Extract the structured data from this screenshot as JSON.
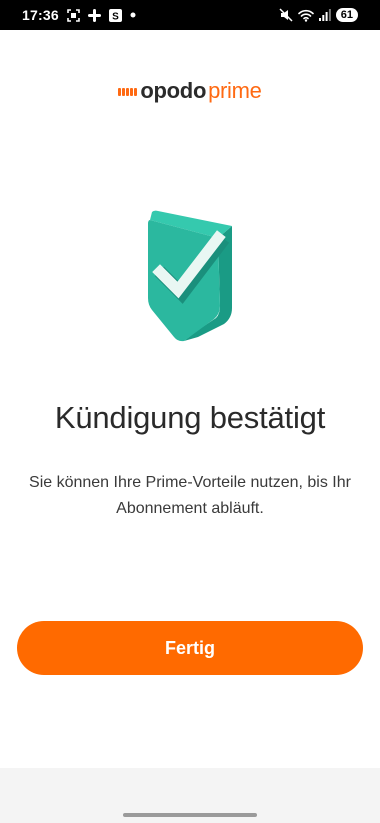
{
  "status_bar": {
    "time": "17:36",
    "battery": "61",
    "icons": [
      "screenshot-icon",
      "slack-icon",
      "s-app-icon",
      "notification-dot-icon",
      "mute-icon",
      "wifi-icon",
      "signal-icon",
      "battery-icon"
    ]
  },
  "logo": {
    "brand": "opodo",
    "product": "prime",
    "accent_color": "#ff6a13"
  },
  "confirmation": {
    "icon": "shield-check-icon",
    "title": "Kündigung bestätigt",
    "message": "Sie können Ihre Prime-Vorteile nutzen, bis Ihr Abonnement abläuft."
  },
  "actions": {
    "done_label": "Fertig",
    "button_color": "#ff6a00"
  }
}
